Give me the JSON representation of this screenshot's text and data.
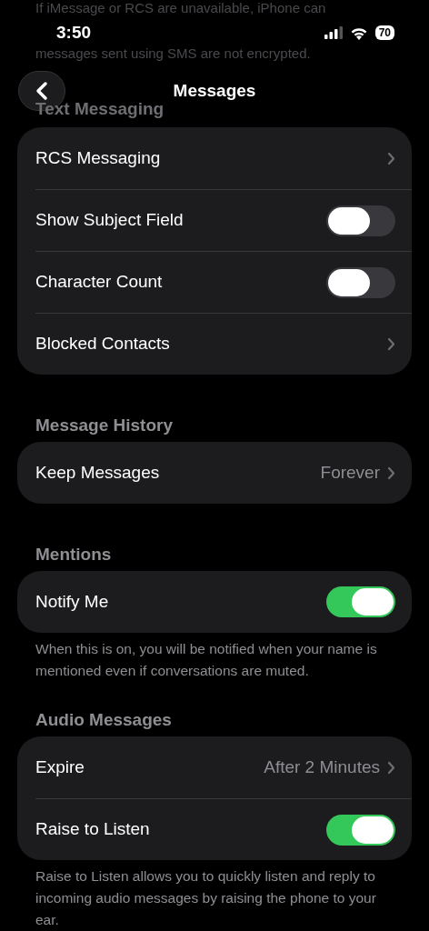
{
  "background_note_lines": [
    "If iMessage or RCS are unavailable, iPhone can",
    "messages sent using SMS are not encrypted."
  ],
  "status_bar": {
    "time": "3:50",
    "battery": "70"
  },
  "nav": {
    "title": "Messages"
  },
  "sections": [
    {
      "header": "Text Messaging",
      "rows": [
        {
          "kind": "link",
          "label": "RCS Messaging"
        },
        {
          "kind": "toggle",
          "label": "Show Subject Field",
          "on": false
        },
        {
          "kind": "toggle",
          "label": "Character Count",
          "on": false
        },
        {
          "kind": "link",
          "label": "Blocked Contacts"
        }
      ]
    },
    {
      "header": "Message History",
      "rows": [
        {
          "kind": "link",
          "label": "Keep Messages",
          "value": "Forever"
        }
      ]
    },
    {
      "header": "Mentions",
      "rows": [
        {
          "kind": "toggle",
          "label": "Notify Me",
          "on": true
        }
      ],
      "footer": "When this is on, you will be notified when your name is mentioned even if conversations are muted."
    },
    {
      "header": "Audio Messages",
      "rows": [
        {
          "kind": "link",
          "label": "Expire",
          "value": "After 2 Minutes"
        },
        {
          "kind": "toggle",
          "label": "Raise to Listen",
          "on": true
        }
      ],
      "footer": "Raise to Listen allows you to quickly listen and reply to incoming audio messages by raising the phone to your ear."
    }
  ]
}
